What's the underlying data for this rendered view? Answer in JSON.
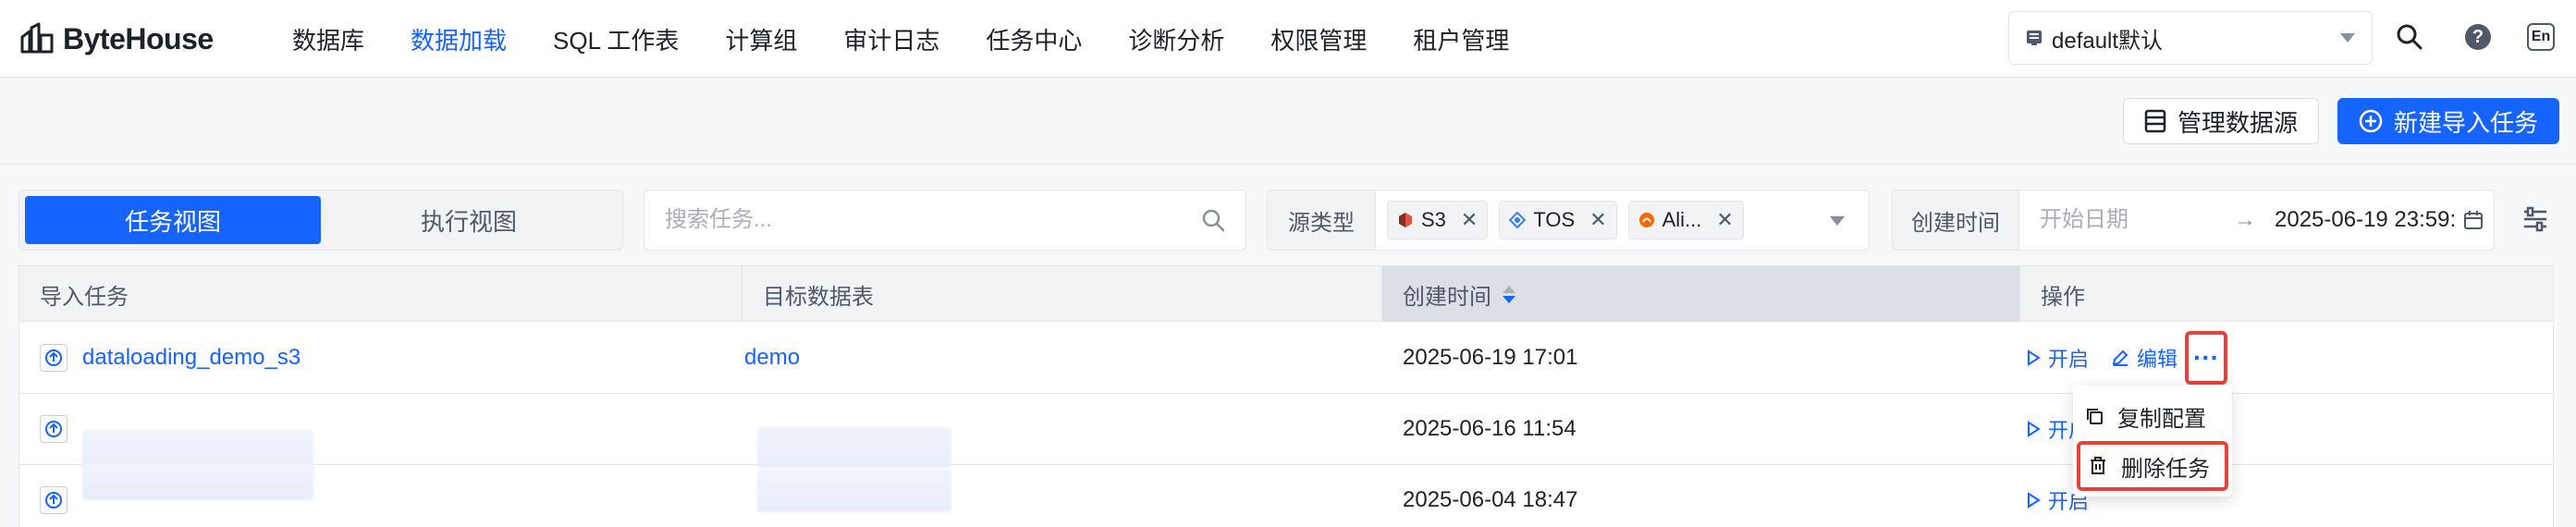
{
  "app": {
    "brand": "ByteHouse"
  },
  "nav": {
    "items": [
      {
        "label": "数据库",
        "active": false
      },
      {
        "label": "数据加载",
        "active": true
      },
      {
        "label": "SQL 工作表",
        "active": false
      },
      {
        "label": "计算组",
        "active": false
      },
      {
        "label": "审计日志",
        "active": false
      },
      {
        "label": "任务中心",
        "active": false
      },
      {
        "label": "诊断分析",
        "active": false
      },
      {
        "label": "权限管理",
        "active": false
      },
      {
        "label": "租户管理",
        "active": false
      }
    ]
  },
  "header": {
    "workspace": "default默认",
    "lang": "En",
    "icons": {
      "search": "search-icon",
      "help": "help-icon",
      "language": "language-icon"
    }
  },
  "toolbar": {
    "manage_sources_label": "管理数据源",
    "new_task_label": "新建导入任务"
  },
  "view_toggle": {
    "task_view": "任务视图",
    "exec_view": "执行视图"
  },
  "search": {
    "placeholder": "搜索任务..."
  },
  "source_filter": {
    "label": "源类型",
    "tags": [
      "S3",
      "TOS",
      "Ali..."
    ]
  },
  "date_filter": {
    "label": "创建时间",
    "start_placeholder": "开始日期",
    "end_value": "2025-06-19 23:59:"
  },
  "table": {
    "columns": [
      "导入任务",
      "目标数据表",
      "创建时间",
      "操作"
    ],
    "rows": [
      {
        "task": "dataloading_demo_s3",
        "target": "demo",
        "created": "2025-06-19 17:01"
      },
      {
        "task": "",
        "target": "",
        "created": "2025-06-16 11:54"
      },
      {
        "task": "",
        "target": "",
        "created": "2025-06-04 18:47"
      }
    ],
    "actions": {
      "start": "开启",
      "edit": "编辑",
      "more": "···"
    }
  },
  "dropdown": {
    "items": [
      "复制配置",
      "删除任务"
    ]
  },
  "colors": {
    "primary": "#1664ff",
    "highlight": "#e8403a"
  }
}
